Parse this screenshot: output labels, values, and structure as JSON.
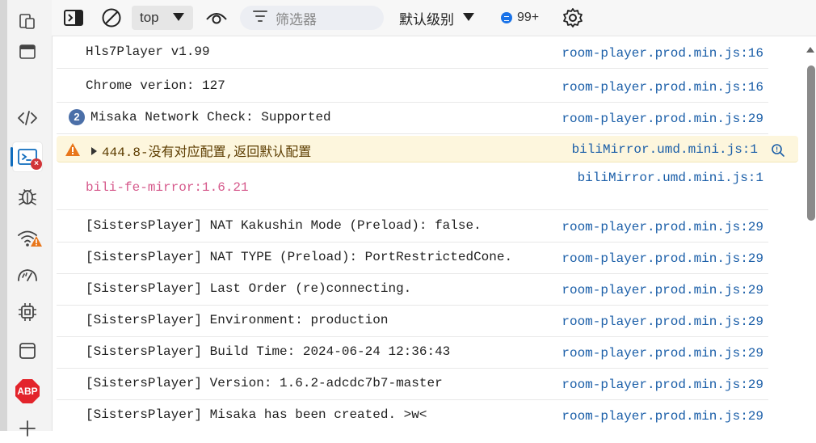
{
  "toolbar": {
    "context_value": "top",
    "filter_placeholder": "筛选器",
    "levels_label": "默认级别",
    "message_count": "99+"
  },
  "console": {
    "rows": [
      {
        "message": "Hls7Player v1.99",
        "source": "room-player.prod.min.js:16"
      },
      {
        "message": "Chrome verion: 127",
        "source": "room-player.prod.min.js:16"
      },
      {
        "count": "2",
        "message": "Misaka Network Check: Supported",
        "source": "room-player.prod.min.js:29"
      },
      {
        "level": "warning",
        "message": "444.8-没有对应配置,返回默认配置",
        "source": "biliMirror.umd.mini.js:1"
      },
      {
        "message": "bili-fe-mirror:1.6.21",
        "source": "biliMirror.umd.mini.js:1",
        "color": "#d65a8c"
      },
      {
        "message": "[SistersPlayer] NAT Kakushin Mode (Preload): false.",
        "source": "room-player.prod.min.js:29"
      },
      {
        "message": "[SistersPlayer] NAT TYPE (Preload): PortRestrictedCone.",
        "source": "room-player.prod.min.js:29"
      },
      {
        "message": "[SistersPlayer] Last Order (re)connecting.",
        "source": "room-player.prod.min.js:29"
      },
      {
        "message": "[SistersPlayer] Environment: production",
        "source": "room-player.prod.min.js:29"
      },
      {
        "message": "[SistersPlayer] Build Time: 2024-06-24 12:36:43",
        "source": "room-player.prod.min.js:29"
      },
      {
        "message": "[SistersPlayer] Version: 1.6.2-adcdc7b7-master",
        "source": "room-player.prod.min.js:29"
      },
      {
        "message": "[SistersPlayer] Misaka has been created. >w<",
        "source": "room-player.prod.min.js:29"
      }
    ]
  },
  "leftbar": {
    "abp_label": "ABP",
    "console_error_badge": "×"
  },
  "colors": {
    "link": "#1a5ea8",
    "warning_bg": "#fdf6dd",
    "warning_icon": "#e8761b",
    "accent": "#0f6cbd"
  },
  "icons": [
    "device-emulation-icon",
    "browser-window-icon",
    "elements-icon",
    "console-icon",
    "bug-icon",
    "network-icon",
    "performance-icon",
    "memory-chip-icon",
    "application-icon",
    "adblock-icon",
    "add-icon",
    "dock-icon",
    "clear-console-icon",
    "live-expression-icon",
    "filter-icon",
    "gear-icon",
    "search-icon"
  ]
}
